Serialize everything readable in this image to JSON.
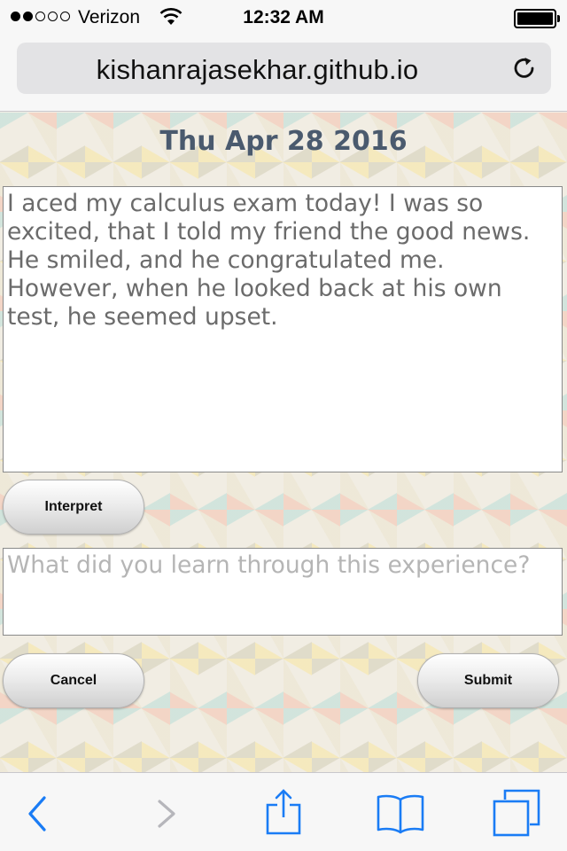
{
  "status_bar": {
    "carrier": "Verizon",
    "time": "12:32 AM",
    "signal_bars_filled": 2,
    "signal_bars_total": 5,
    "battery_level": 1.0
  },
  "browser": {
    "url": "kishanrajasekhar.github.io",
    "reload_icon": "reload-icon"
  },
  "page": {
    "date": "Thu Apr 28 2016",
    "entry_text": "I aced my calculus exam today! I was so excited, that I told my friend the good news. He smiled, and he congratulated me. However, when he looked back at his own test, he seemed upset.",
    "interpret_label": "Interpret",
    "reflection_placeholder": "What did you learn through this experience?",
    "cancel_label": "Cancel",
    "submit_label": "Submit"
  },
  "toolbar": {
    "icons": [
      "back-icon",
      "forward-icon",
      "share-icon",
      "bookmarks-icon",
      "tabs-icon"
    ],
    "accent_color": "#1a7cf5",
    "disabled_color": "#b6b6bb"
  }
}
